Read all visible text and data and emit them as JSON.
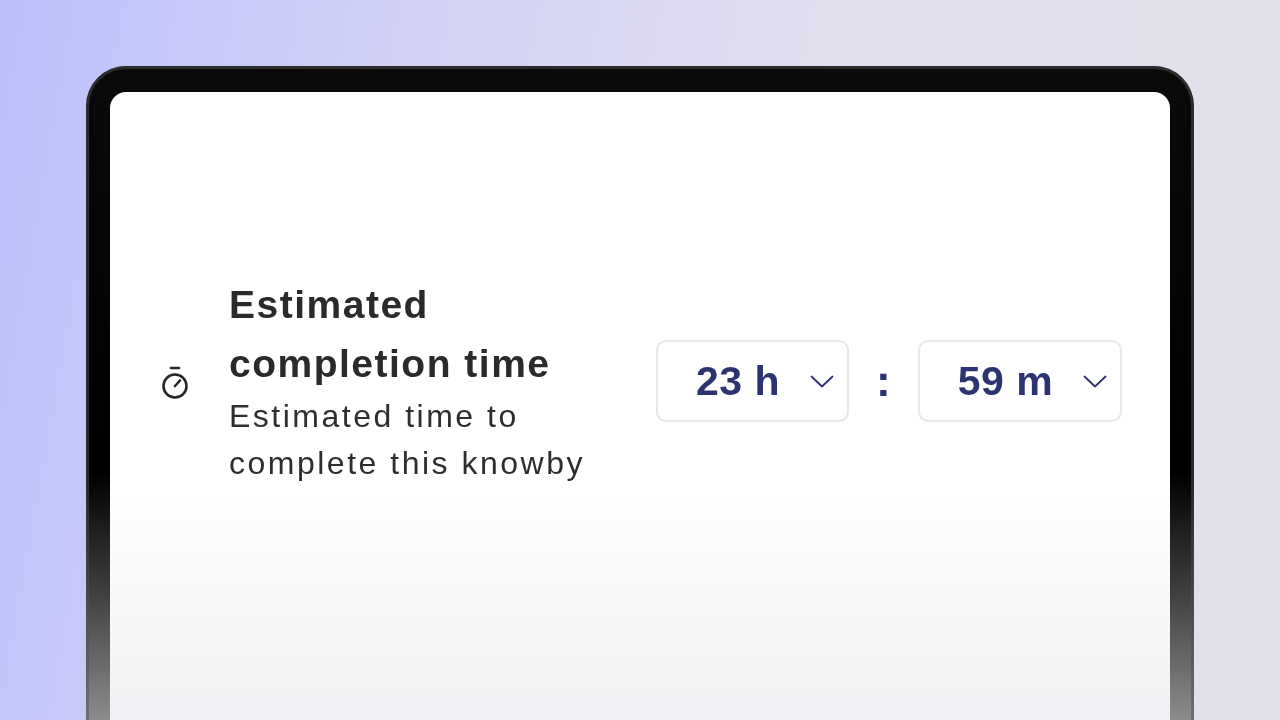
{
  "setting": {
    "title": "Estimated completion time",
    "description": "Estimated time to complete this knowby",
    "selects": [
      {
        "value": "23 h"
      },
      {
        "value": "59 m"
      }
    ],
    "separator": ":"
  }
}
